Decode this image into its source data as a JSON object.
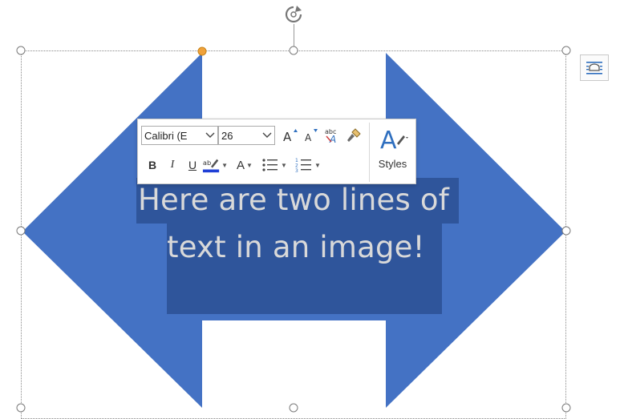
{
  "document": {
    "text_lines": [
      "Here are two lines of",
      "text in an image!"
    ],
    "shape": "left-right-arrow",
    "shape_color": "#4472c4",
    "highlight_color": "#2f559b",
    "text_color": "#d9d9d9"
  },
  "mini_toolbar": {
    "font_name": "Calibri (E",
    "font_size": "26",
    "styles_label": "Styles",
    "icons": {
      "grow_font": "grow-font-icon",
      "shrink_font": "shrink-font-icon",
      "clear_formatting": "clear-formatting-icon",
      "format_painter": "format-painter-icon",
      "styles": "styles-icon",
      "bold": "B",
      "italic": "I",
      "underline": "U",
      "highlight": "text-highlight-color-icon",
      "font_color": "A",
      "bullets": "bullets-icon",
      "numbering": "numbering-icon"
    },
    "highlight_swatch_color": "#1f3fd6"
  },
  "layout_options": {
    "icon": "layout-options-icon"
  }
}
